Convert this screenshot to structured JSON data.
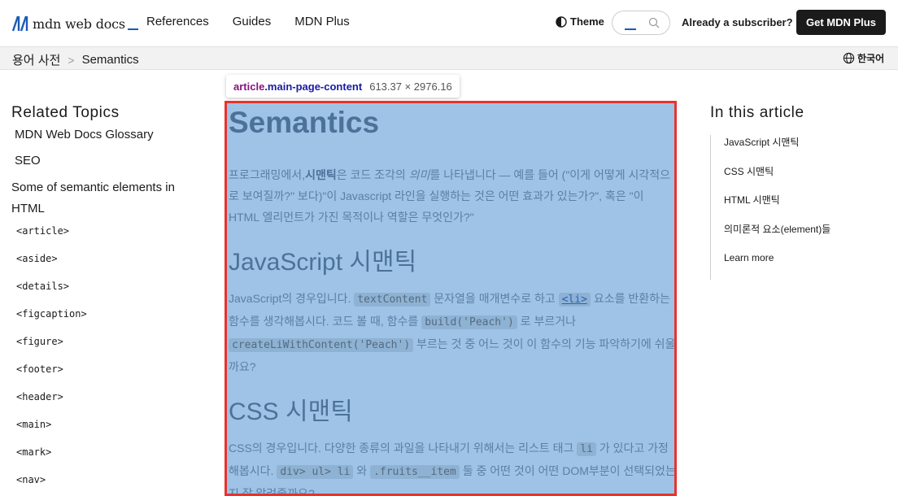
{
  "header": {
    "logo_text": "mdn web docs",
    "nav": [
      "References",
      "Guides",
      "MDN Plus"
    ],
    "theme_label": "Theme",
    "search_value": "",
    "subscriber_label": "Already a subscriber?",
    "plus_button_label": "Get MDN Plus"
  },
  "breadcrumb": {
    "items": [
      "용어 사전",
      "Semantics"
    ],
    "separator": ">"
  },
  "language_label": "한국어",
  "inspector": {
    "tag": "article",
    "class": ".main-page-content",
    "size": "613.37 × 2976.16"
  },
  "sidebar": {
    "heading": "Related Topics",
    "links": [
      "MDN Web Docs Glossary",
      "SEO"
    ],
    "sub_heading": "Some of semantic elements in HTML",
    "elements": [
      "<article>",
      "<aside>",
      "<details>",
      "<figcaption>",
      "<figure>",
      "<footer>",
      "<header>",
      "<main>",
      "<mark>",
      "<nav>"
    ]
  },
  "article": {
    "title": "Semantics",
    "intro": {
      "p1": "프로그래밍에서,",
      "bold": "시맨틱",
      "p2": "은 코드 조각의 ",
      "italic": "의미",
      "p3": "를 나타냅니다 — 예를 들어 (\"이게 어떻게 시각적으로 보여질까?\" 보다)\"이 Javascript 라인을 실행하는 것은 어떤 효과가 있는가?\", 혹은 \"이 HTML 엘리먼트가 가진 목적이나 역할은 무엇인가?\""
    },
    "js_heading": "JavaScript 시맨틱",
    "js_para": {
      "t1": "JavaScript의 경우입니다. ",
      "c1": "textContent",
      "t2": " 문자열을 매개변수로 하고 ",
      "c2": "<li>",
      "t3": " 요소를 반환하는 함수를 생각해봅시다. 코드 볼 때, 함수를 ",
      "c3": "build('Peach')",
      "t4": " 로 부르거나 ",
      "c4": "createLiWithContent('Peach')",
      "t5": " 부르는 것 중 어느 것이 이 함수의 기능 파악하기에 쉬울까요?"
    },
    "css_heading": "CSS 시맨틱",
    "css_para": {
      "t1": "CSS의 경우입니다. 다양한 종류의 과일을 나타내기 위해서는 리스트 태그 ",
      "c1": "li",
      "t2": " 가 있다고 가정해봅시다. ",
      "c2": "div> ul> li",
      "t3": " 와 ",
      "c3": ".fruits__item",
      "t4": " 둘 중 어떤 것이 어떤 DOM부분이 선택되었는지 잘 알려줄까요?"
    }
  },
  "toc": {
    "heading": "In this article",
    "items": [
      "JavaScript 시맨틱",
      "CSS 시맨틱",
      "HTML 시맨틱",
      "의미론적 요소(element)들",
      "Learn more"
    ]
  },
  "colors": {
    "brand": "#1b5cb5",
    "highlight": "#9ec3e6",
    "outline": "#e8322c"
  }
}
